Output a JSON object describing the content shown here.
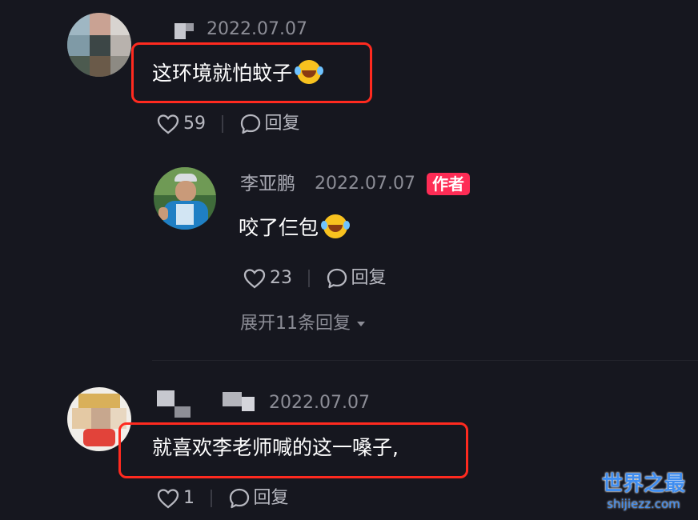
{
  "comments": [
    {
      "name": "",
      "date": "2022.07.07",
      "text": "这环境就怕蚊子",
      "emoji": "rolling-laughing-emoji",
      "likes": "59",
      "reply_label": "回复",
      "highlighted": true
    },
    {
      "name": "",
      "date": "2022.07.07",
      "text": "就喜欢李老师喊的这一嗓子,",
      "likes": "1",
      "reply_label": "回复",
      "highlighted": true
    }
  ],
  "reply": {
    "name": "李亚鹏",
    "date": "2022.07.07",
    "badge": "作者",
    "text": "咬了仨包",
    "emoji": "rolling-laughing-emoji",
    "likes": "23",
    "reply_label": "回复"
  },
  "expand_replies": "展开11条回复",
  "watermark": {
    "title": "世界之最",
    "url": "shijiezz.com"
  },
  "colors": {
    "highlight": "#ff2a1f",
    "badge": "#fe2c55",
    "background": "#16171f"
  },
  "icons": [
    "heart-icon",
    "chat-bubble-icon",
    "chevron-down-icon"
  ]
}
